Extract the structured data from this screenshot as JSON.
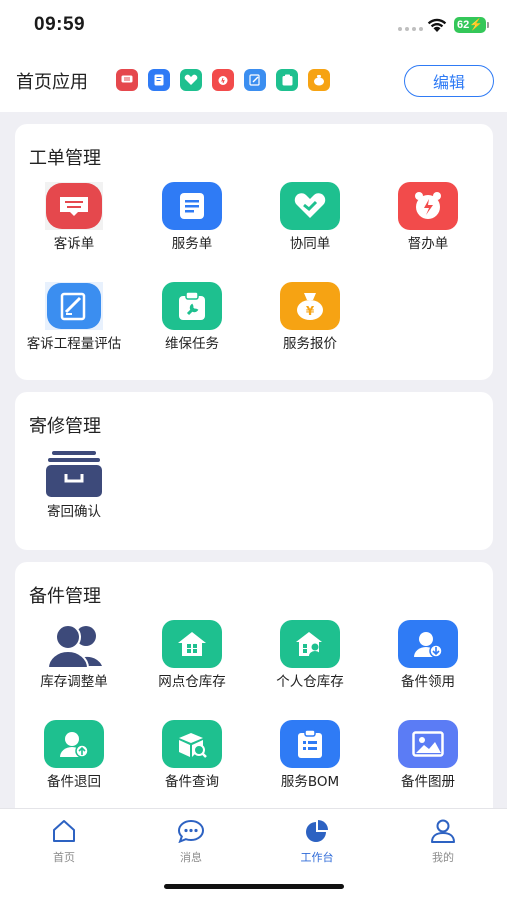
{
  "status_bar": {
    "time": "09:59",
    "battery": "62"
  },
  "header": {
    "title": "首页应用",
    "edit_label": "编辑"
  },
  "sections": [
    {
      "title": "工单管理",
      "items": [
        {
          "label": "客诉单",
          "icon": "complaint-icon",
          "color": "#e5484d"
        },
        {
          "label": "服务单",
          "icon": "service-order-icon",
          "color": "#2f7bf5"
        },
        {
          "label": "协同单",
          "icon": "handshake-icon",
          "color": "#1ec08f"
        },
        {
          "label": "督办单",
          "icon": "alarm-clock-icon",
          "color": "#f24b4b"
        },
        {
          "label": "客诉工程量评估",
          "icon": "edit-doc-icon",
          "color": "#3b8ef0"
        },
        {
          "label": "维保任务",
          "icon": "maintenance-icon",
          "color": "#1ec08f"
        },
        {
          "label": "服务报价",
          "icon": "money-bag-icon",
          "color": "#f6a313"
        }
      ]
    },
    {
      "title": "寄修管理",
      "items": [
        {
          "label": "寄回确认",
          "icon": "archive-box-icon",
          "color": "#3d4a7a"
        }
      ]
    },
    {
      "title": "备件管理",
      "items": [
        {
          "label": "库存调整单",
          "icon": "users-icon",
          "color": "#3d4a7a"
        },
        {
          "label": "网点仓库存",
          "icon": "warehouse-icon",
          "color": "#1ec08f"
        },
        {
          "label": "个人仓库存",
          "icon": "personal-warehouse-icon",
          "color": "#1ec08f"
        },
        {
          "label": "备件领用",
          "icon": "user-receive-icon",
          "color": "#2f7bf5"
        },
        {
          "label": "备件退回",
          "icon": "user-return-icon",
          "color": "#1ec08f"
        },
        {
          "label": "备件查询",
          "icon": "box-search-icon",
          "color": "#1ec08f"
        },
        {
          "label": "服务BOM",
          "icon": "clipboard-icon",
          "color": "#2f7bf5"
        },
        {
          "label": "备件图册",
          "icon": "image-icon",
          "color": "#5b7cf5"
        }
      ]
    }
  ],
  "tabbar": [
    {
      "label": "首页",
      "icon": "home-icon",
      "active": false
    },
    {
      "label": "消息",
      "icon": "message-icon",
      "active": false
    },
    {
      "label": "工作台",
      "icon": "pie-chart-icon",
      "active": true
    },
    {
      "label": "我的",
      "icon": "profile-icon",
      "active": false
    }
  ]
}
